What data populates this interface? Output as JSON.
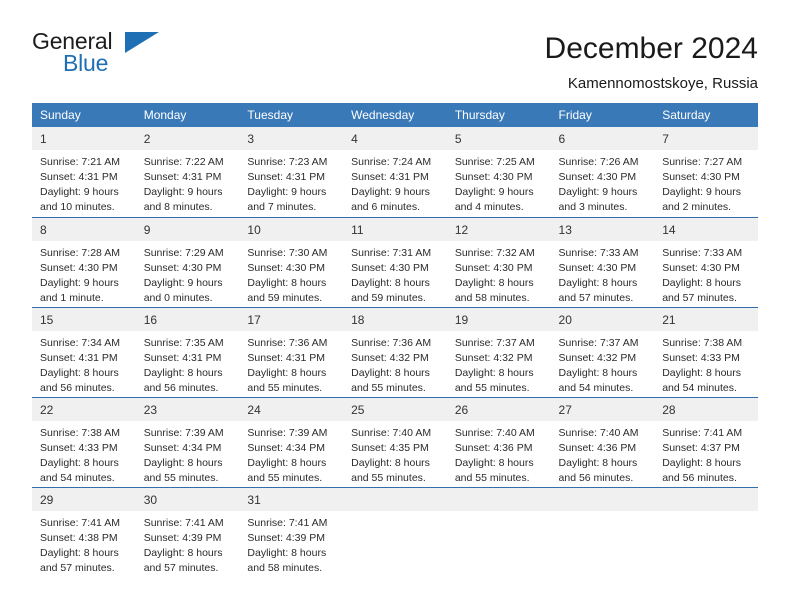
{
  "brand": {
    "name_part1": "General",
    "name_part2": "Blue",
    "logo_icon": "triangle-icon"
  },
  "header": {
    "month_title": "December 2024",
    "location": "Kamennomostskoye, Russia"
  },
  "calendar": {
    "weekday_headers": [
      "Sunday",
      "Monday",
      "Tuesday",
      "Wednesday",
      "Thursday",
      "Friday",
      "Saturday"
    ],
    "accent_color": "#3a79b8",
    "daynum_band_color": "#f0f0f0",
    "weeks": [
      [
        {
          "day": "1",
          "sunrise": "Sunrise: 7:21 AM",
          "sunset": "Sunset: 4:31 PM",
          "daylight_line1": "Daylight: 9 hours",
          "daylight_line2": "and 10 minutes."
        },
        {
          "day": "2",
          "sunrise": "Sunrise: 7:22 AM",
          "sunset": "Sunset: 4:31 PM",
          "daylight_line1": "Daylight: 9 hours",
          "daylight_line2": "and 8 minutes."
        },
        {
          "day": "3",
          "sunrise": "Sunrise: 7:23 AM",
          "sunset": "Sunset: 4:31 PM",
          "daylight_line1": "Daylight: 9 hours",
          "daylight_line2": "and 7 minutes."
        },
        {
          "day": "4",
          "sunrise": "Sunrise: 7:24 AM",
          "sunset": "Sunset: 4:31 PM",
          "daylight_line1": "Daylight: 9 hours",
          "daylight_line2": "and 6 minutes."
        },
        {
          "day": "5",
          "sunrise": "Sunrise: 7:25 AM",
          "sunset": "Sunset: 4:30 PM",
          "daylight_line1": "Daylight: 9 hours",
          "daylight_line2": "and 4 minutes."
        },
        {
          "day": "6",
          "sunrise": "Sunrise: 7:26 AM",
          "sunset": "Sunset: 4:30 PM",
          "daylight_line1": "Daylight: 9 hours",
          "daylight_line2": "and 3 minutes."
        },
        {
          "day": "7",
          "sunrise": "Sunrise: 7:27 AM",
          "sunset": "Sunset: 4:30 PM",
          "daylight_line1": "Daylight: 9 hours",
          "daylight_line2": "and 2 minutes."
        }
      ],
      [
        {
          "day": "8",
          "sunrise": "Sunrise: 7:28 AM",
          "sunset": "Sunset: 4:30 PM",
          "daylight_line1": "Daylight: 9 hours",
          "daylight_line2": "and 1 minute."
        },
        {
          "day": "9",
          "sunrise": "Sunrise: 7:29 AM",
          "sunset": "Sunset: 4:30 PM",
          "daylight_line1": "Daylight: 9 hours",
          "daylight_line2": "and 0 minutes."
        },
        {
          "day": "10",
          "sunrise": "Sunrise: 7:30 AM",
          "sunset": "Sunset: 4:30 PM",
          "daylight_line1": "Daylight: 8 hours",
          "daylight_line2": "and 59 minutes."
        },
        {
          "day": "11",
          "sunrise": "Sunrise: 7:31 AM",
          "sunset": "Sunset: 4:30 PM",
          "daylight_line1": "Daylight: 8 hours",
          "daylight_line2": "and 59 minutes."
        },
        {
          "day": "12",
          "sunrise": "Sunrise: 7:32 AM",
          "sunset": "Sunset: 4:30 PM",
          "daylight_line1": "Daylight: 8 hours",
          "daylight_line2": "and 58 minutes."
        },
        {
          "day": "13",
          "sunrise": "Sunrise: 7:33 AM",
          "sunset": "Sunset: 4:30 PM",
          "daylight_line1": "Daylight: 8 hours",
          "daylight_line2": "and 57 minutes."
        },
        {
          "day": "14",
          "sunrise": "Sunrise: 7:33 AM",
          "sunset": "Sunset: 4:30 PM",
          "daylight_line1": "Daylight: 8 hours",
          "daylight_line2": "and 57 minutes."
        }
      ],
      [
        {
          "day": "15",
          "sunrise": "Sunrise: 7:34 AM",
          "sunset": "Sunset: 4:31 PM",
          "daylight_line1": "Daylight: 8 hours",
          "daylight_line2": "and 56 minutes."
        },
        {
          "day": "16",
          "sunrise": "Sunrise: 7:35 AM",
          "sunset": "Sunset: 4:31 PM",
          "daylight_line1": "Daylight: 8 hours",
          "daylight_line2": "and 56 minutes."
        },
        {
          "day": "17",
          "sunrise": "Sunrise: 7:36 AM",
          "sunset": "Sunset: 4:31 PM",
          "daylight_line1": "Daylight: 8 hours",
          "daylight_line2": "and 55 minutes."
        },
        {
          "day": "18",
          "sunrise": "Sunrise: 7:36 AM",
          "sunset": "Sunset: 4:32 PM",
          "daylight_line1": "Daylight: 8 hours",
          "daylight_line2": "and 55 minutes."
        },
        {
          "day": "19",
          "sunrise": "Sunrise: 7:37 AM",
          "sunset": "Sunset: 4:32 PM",
          "daylight_line1": "Daylight: 8 hours",
          "daylight_line2": "and 55 minutes."
        },
        {
          "day": "20",
          "sunrise": "Sunrise: 7:37 AM",
          "sunset": "Sunset: 4:32 PM",
          "daylight_line1": "Daylight: 8 hours",
          "daylight_line2": "and 54 minutes."
        },
        {
          "day": "21",
          "sunrise": "Sunrise: 7:38 AM",
          "sunset": "Sunset: 4:33 PM",
          "daylight_line1": "Daylight: 8 hours",
          "daylight_line2": "and 54 minutes."
        }
      ],
      [
        {
          "day": "22",
          "sunrise": "Sunrise: 7:38 AM",
          "sunset": "Sunset: 4:33 PM",
          "daylight_line1": "Daylight: 8 hours",
          "daylight_line2": "and 54 minutes."
        },
        {
          "day": "23",
          "sunrise": "Sunrise: 7:39 AM",
          "sunset": "Sunset: 4:34 PM",
          "daylight_line1": "Daylight: 8 hours",
          "daylight_line2": "and 55 minutes."
        },
        {
          "day": "24",
          "sunrise": "Sunrise: 7:39 AM",
          "sunset": "Sunset: 4:34 PM",
          "daylight_line1": "Daylight: 8 hours",
          "daylight_line2": "and 55 minutes."
        },
        {
          "day": "25",
          "sunrise": "Sunrise: 7:40 AM",
          "sunset": "Sunset: 4:35 PM",
          "daylight_line1": "Daylight: 8 hours",
          "daylight_line2": "and 55 minutes."
        },
        {
          "day": "26",
          "sunrise": "Sunrise: 7:40 AM",
          "sunset": "Sunset: 4:36 PM",
          "daylight_line1": "Daylight: 8 hours",
          "daylight_line2": "and 55 minutes."
        },
        {
          "day": "27",
          "sunrise": "Sunrise: 7:40 AM",
          "sunset": "Sunset: 4:36 PM",
          "daylight_line1": "Daylight: 8 hours",
          "daylight_line2": "and 56 minutes."
        },
        {
          "day": "28",
          "sunrise": "Sunrise: 7:41 AM",
          "sunset": "Sunset: 4:37 PM",
          "daylight_line1": "Daylight: 8 hours",
          "daylight_line2": "and 56 minutes."
        }
      ],
      [
        {
          "day": "29",
          "sunrise": "Sunrise: 7:41 AM",
          "sunset": "Sunset: 4:38 PM",
          "daylight_line1": "Daylight: 8 hours",
          "daylight_line2": "and 57 minutes."
        },
        {
          "day": "30",
          "sunrise": "Sunrise: 7:41 AM",
          "sunset": "Sunset: 4:39 PM",
          "daylight_line1": "Daylight: 8 hours",
          "daylight_line2": "and 57 minutes."
        },
        {
          "day": "31",
          "sunrise": "Sunrise: 7:41 AM",
          "sunset": "Sunset: 4:39 PM",
          "daylight_line1": "Daylight: 8 hours",
          "daylight_line2": "and 58 minutes."
        },
        {
          "day": "",
          "sunrise": "",
          "sunset": "",
          "daylight_line1": "",
          "daylight_line2": ""
        },
        {
          "day": "",
          "sunrise": "",
          "sunset": "",
          "daylight_line1": "",
          "daylight_line2": ""
        },
        {
          "day": "",
          "sunrise": "",
          "sunset": "",
          "daylight_line1": "",
          "daylight_line2": ""
        },
        {
          "day": "",
          "sunrise": "",
          "sunset": "",
          "daylight_line1": "",
          "daylight_line2": ""
        }
      ]
    ]
  }
}
